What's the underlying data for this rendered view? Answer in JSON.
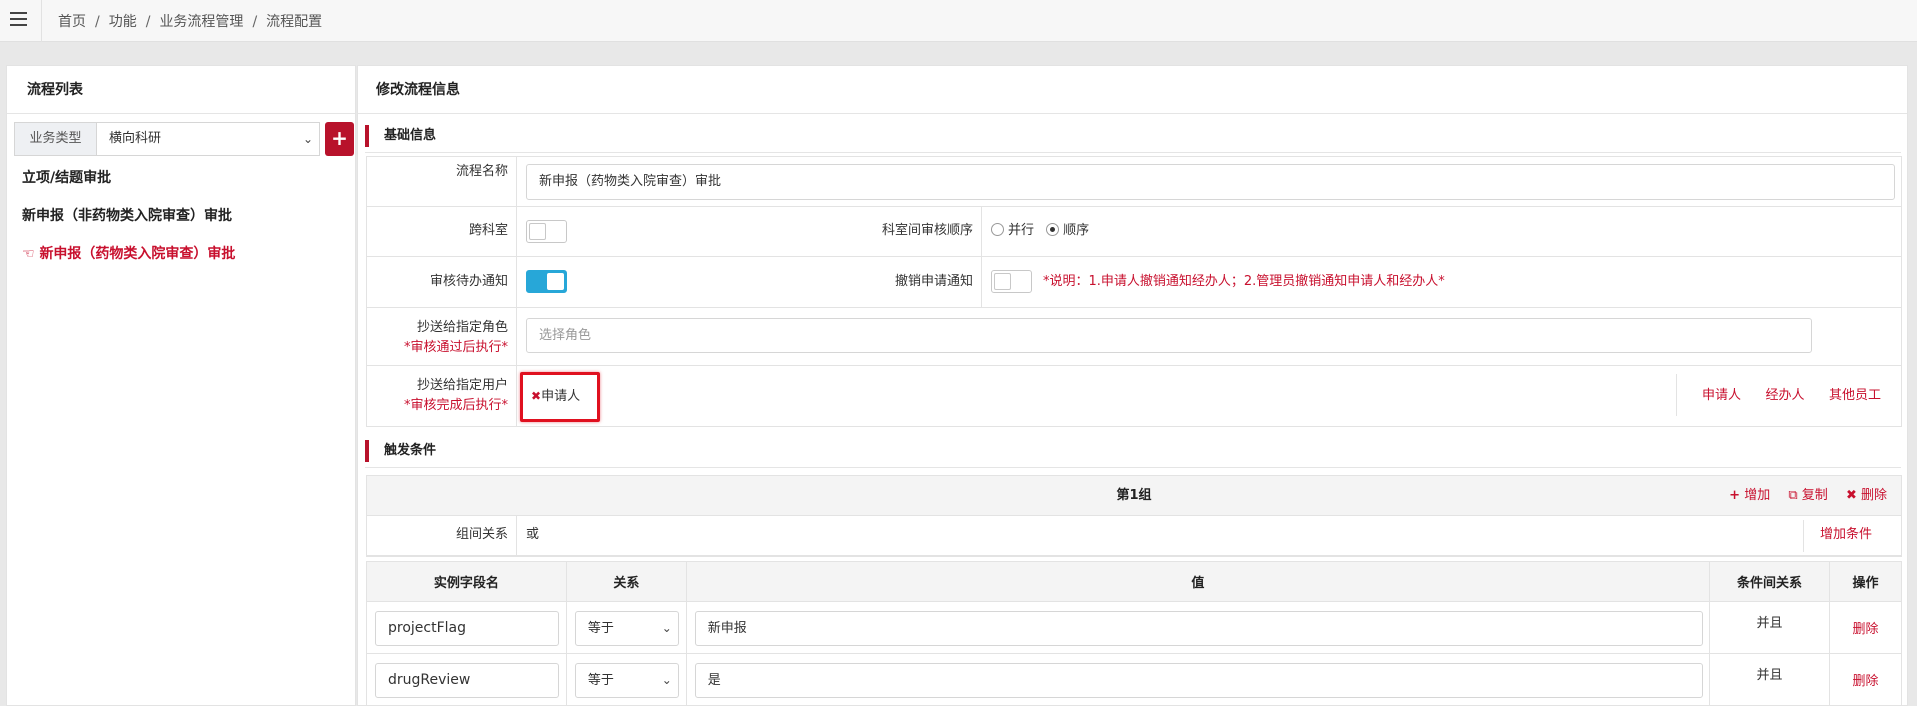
{
  "breadcrumb": [
    "首页",
    "功能",
    "业务流程管理",
    "流程配置"
  ],
  "left": {
    "title": "流程列表",
    "type_label": "业务类型",
    "type_value": "横向科研",
    "add_symbol": "+",
    "flows": [
      {
        "label": "立项/结题审批",
        "active": false
      },
      {
        "label": "新申报（非药物类入院审查）审批",
        "active": false
      },
      {
        "label": "新申报（药物类入院审查）审批",
        "active": true
      }
    ]
  },
  "right": {
    "title": "修改流程信息",
    "basic_section": "基础信息",
    "form": {
      "name_label": "流程名称",
      "name_value": "新申报（药物类入院审查）审批",
      "cross_dept_label": "跨科室",
      "cross_dept_on": false,
      "order_label": "科室间审核顺序",
      "order_options": [
        "并行",
        "顺序"
      ],
      "order_selected": "顺序",
      "pending_notify_label": "审核待办通知",
      "pending_notify_on": true,
      "revoke_notify_label": "撤销申请通知",
      "revoke_notify_on": false,
      "revoke_note": "*说明：1.申请人撤销通知经办人；2.管理员撤销通知申请人和经办人*",
      "cc_role_label": "抄送给指定角色",
      "cc_role_req": "*审核通过后执行*",
      "cc_role_placeholder": "选择角色",
      "cc_user_label": "抄送给指定用户",
      "cc_user_req": "*审核完成后执行*",
      "cc_user_tag": "申请人",
      "cc_user_links": [
        "申请人",
        "经办人",
        "其他员工"
      ]
    },
    "trigger_section": "触发条件",
    "group": {
      "title": "第1组",
      "actions": {
        "add": "增加",
        "copy": "复制",
        "delete": "删除"
      },
      "rel_label": "组间关系",
      "rel_value": "或",
      "add_condition": "增加条件"
    },
    "conditions": {
      "headers": [
        "实例字段名",
        "关系",
        "值",
        "条件间关系",
        "操作"
      ],
      "rows": [
        {
          "field": "projectFlag",
          "op": "等于",
          "value": "新申报",
          "logic": "并且",
          "action": "删除"
        },
        {
          "field": "drugReview",
          "op": "等于",
          "value": "是",
          "logic": "并且",
          "action": "删除"
        }
      ]
    }
  },
  "colors": {
    "accent": "#b8122b",
    "toggle_on": "#27a7d8",
    "highlight_box": "#e0101f"
  }
}
